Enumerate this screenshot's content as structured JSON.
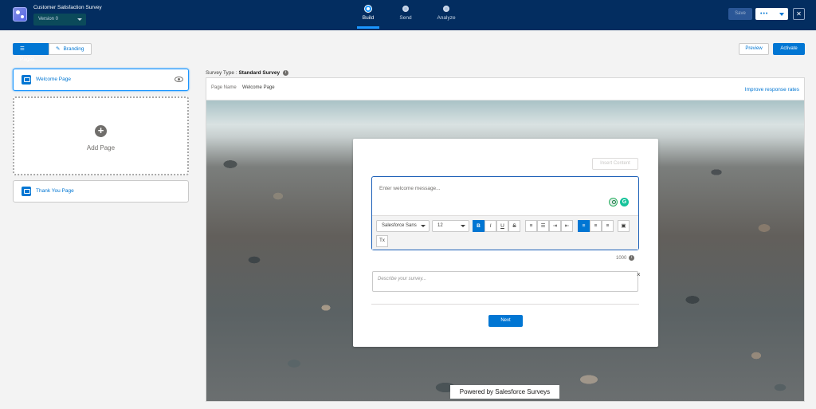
{
  "header": {
    "survey_title": "Customer Satisfaction Survey",
    "version": "Version 0",
    "steps": [
      {
        "label": "Build",
        "active": true
      },
      {
        "label": "Send",
        "active": false
      },
      {
        "label": "Analyze",
        "active": false
      }
    ],
    "save_label": "Save",
    "more_label": "•••",
    "close_label": "✕"
  },
  "left_panel": {
    "tabs": [
      {
        "label": "Pages",
        "active": true
      },
      {
        "label": "Branding",
        "active": false
      }
    ],
    "pages": [
      {
        "label": "Welcome Page",
        "selected": true
      },
      {
        "label": "Thank You Page",
        "selected": false
      }
    ],
    "add_page_label": "Add Page",
    "add_page_symbol": "+"
  },
  "actions": {
    "preview_label": "Preview",
    "activate_label": "Activate"
  },
  "survey_type": {
    "prefix": "Survey Type : ",
    "value": "Standard Survey",
    "info": "i"
  },
  "canvas": {
    "page_name_label": "Page Name",
    "page_name_value": "Welcome Page",
    "improve_link": "Improve response rates"
  },
  "card": {
    "insert_content_label": "Insert Content",
    "welcome_placeholder": "Enter welcome message...",
    "font_family": "Salesforce Sans",
    "font_size": "12",
    "toolbar_buttons": {
      "bold": "B",
      "italic": "I",
      "underline": "U",
      "strike": "S",
      "bullet": "≡",
      "numbered": "☰",
      "indent": "⇥",
      "outdent": "⇤",
      "align_left": "≡",
      "align_center": "≡",
      "align_right": "≡",
      "image": "▣",
      "clear_format": "Tx"
    },
    "char_limit": "1000",
    "char_info": "i",
    "description_placeholder": "Describe your survey...",
    "description_close": "×",
    "next_label": "Next"
  },
  "footer": {
    "powered_by": "Powered by Salesforce Surveys"
  },
  "colors": {
    "header_bg": "#032d60",
    "brand_blue": "#0176d3",
    "accent": "#1b96ff"
  }
}
